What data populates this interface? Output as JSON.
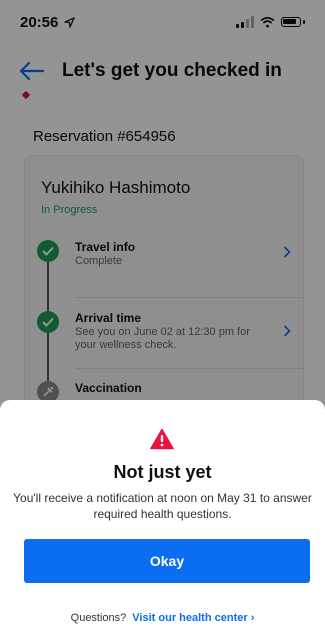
{
  "status_bar": {
    "time": "20:56",
    "location_icon": "location-arrow-icon",
    "signal_icon": "signal-bars-icon",
    "wifi_icon": "wifi-icon",
    "battery_icon": "battery-icon"
  },
  "header": {
    "back_icon": "arrow-left-icon",
    "title": "Let's get you checked in"
  },
  "reservation": {
    "label": "Reservation #654956"
  },
  "guest": {
    "name": "Yukihiko Hashimoto",
    "status": "In Progress"
  },
  "steps": [
    {
      "title": "Travel info",
      "subtitle": "Complete",
      "state": "complete"
    },
    {
      "title": "Arrival time",
      "subtitle": "See you on June 02 at 12:30 pm for your wellness check.",
      "state": "complete"
    },
    {
      "title": "Vaccination",
      "subtitle": "",
      "state": "pending"
    }
  ],
  "modal": {
    "icon": "warning-icon",
    "title": "Not just yet",
    "message": "You'll receive a notification at noon on May 31 to answer required health questions.",
    "button_label": "Okay",
    "questions_label": "Questions?",
    "link_label": "Visit our health center"
  },
  "colors": {
    "accent_blue": "#0b6df0",
    "success_green": "#1f9d57",
    "warning_red": "#e8143c"
  }
}
